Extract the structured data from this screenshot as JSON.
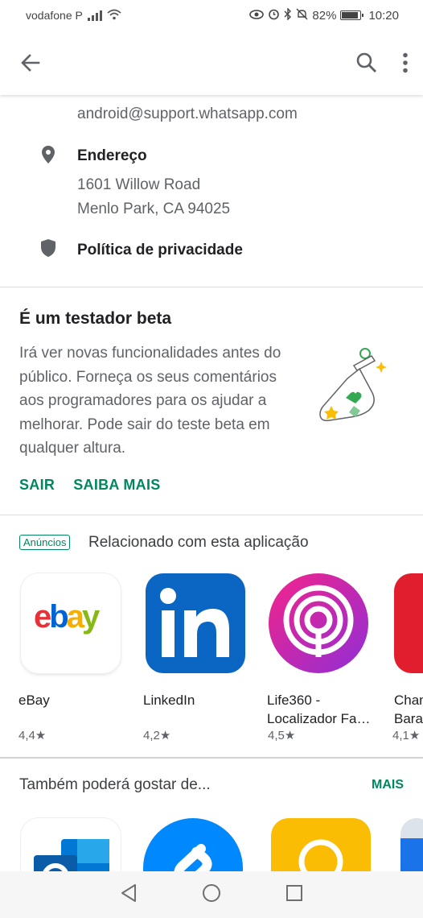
{
  "status_bar": {
    "carrier": "vodafone P",
    "battery_percent": "82%",
    "time": "10:20",
    "icons": [
      "signal-icon",
      "wifi-icon",
      "eye-icon",
      "alarm-icon",
      "bluetooth-icon",
      "mute-icon",
      "battery-icon"
    ]
  },
  "app_bar": {
    "icons": [
      "back-arrow-icon",
      "search-icon",
      "more-vert-icon"
    ]
  },
  "developer": {
    "email": "android@support.whatsapp.com",
    "address_label": "Endereço",
    "address_line1": "1601 Willow Road",
    "address_line2": "Menlo Park, CA 94025",
    "privacy_label": "Política de privacidade"
  },
  "beta": {
    "title": "É um testador beta",
    "body": "Irá ver novas funcionalidades antes do público. Forneça os seus comentários aos programadores para os ajudar a melhorar. Pode sair do teste beta em qualquer altura.",
    "leave_label": "SAIR",
    "learn_more_label": "SAIBA MAIS"
  },
  "related": {
    "ads_badge": "Anúncios",
    "title": "Relacionado com esta aplicação",
    "apps": [
      {
        "name": "eBay",
        "rating": "4,4★"
      },
      {
        "name": "LinkedIn",
        "rating": "4,2★"
      },
      {
        "name": "Life360 - Localizador Fa…",
        "rating": "4,5★"
      },
      {
        "name": "Chan Barat",
        "rating": "4,1★"
      }
    ]
  },
  "also_like": {
    "title": "Também poderá gostar de...",
    "more_label": "MAIS"
  },
  "colors": {
    "accent_green": "#01875f",
    "linkedin_blue": "#0a66c2",
    "life360_magenta": "#d6137a",
    "shazam_blue": "#0088ff"
  }
}
